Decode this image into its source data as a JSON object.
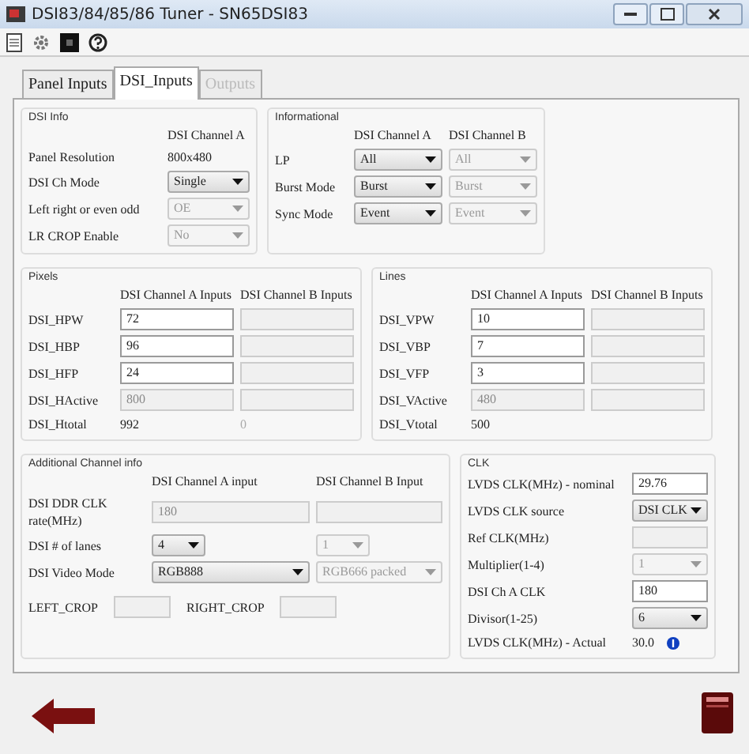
{
  "window": {
    "title": "DSI83/84/85/86 Tuner - SN65DSI83"
  },
  "tabs": [
    {
      "label": "Panel Inputs",
      "selected": false,
      "disabled": false
    },
    {
      "label": "DSI_Inputs",
      "selected": true,
      "disabled": false
    },
    {
      "label": "Outputs",
      "selected": false,
      "disabled": true
    }
  ],
  "dsi_info": {
    "title": "DSI Info",
    "headers": [
      "DSI Channel A"
    ],
    "rows": [
      {
        "label": "Panel Resolution",
        "a": {
          "kind": "text",
          "value": "800x480",
          "disabled": false
        }
      },
      {
        "label": "DSI Ch Mode",
        "a": {
          "kind": "select",
          "value": "Single",
          "disabled": false
        }
      },
      {
        "label": "Left right or even odd",
        "a": {
          "kind": "select",
          "value": "OE",
          "disabled": true
        }
      },
      {
        "label": "LR CROP Enable",
        "a": {
          "kind": "select",
          "value": "No",
          "disabled": true
        }
      }
    ]
  },
  "informational": {
    "title": "Informational",
    "headers": [
      "DSI Channel A",
      "DSI Channel B"
    ],
    "rows": [
      {
        "label": "LP",
        "a": {
          "kind": "select",
          "value": "All",
          "disabled": false
        },
        "b": {
          "kind": "select",
          "value": "All",
          "disabled": true
        }
      },
      {
        "label": "Burst Mode",
        "a": {
          "kind": "select",
          "value": "Burst",
          "disabled": false
        },
        "b": {
          "kind": "select",
          "value": "Burst",
          "disabled": true
        }
      },
      {
        "label": "Sync Mode",
        "a": {
          "kind": "select",
          "value": "Event",
          "disabled": false
        },
        "b": {
          "kind": "select",
          "value": "Event",
          "disabled": true
        }
      }
    ]
  },
  "pixels": {
    "title": "Pixels",
    "headers": [
      "DSI Channel A Inputs",
      "DSI Channel B Inputs"
    ],
    "rows": [
      {
        "label": "DSI_HPW",
        "a": {
          "kind": "input",
          "value": "72",
          "disabled": false
        },
        "b": {
          "kind": "input",
          "disabled": true
        }
      },
      {
        "label": "DSI_HBP",
        "a": {
          "kind": "input",
          "value": "96",
          "disabled": false
        },
        "b": {
          "kind": "input",
          "disabled": true
        }
      },
      {
        "label": "DSI_HFP",
        "a": {
          "kind": "input",
          "value": "24",
          "disabled": false
        },
        "b": {
          "kind": "input",
          "disabled": true
        }
      },
      {
        "label": "DSI_HActive",
        "a": {
          "kind": "input",
          "value": "800",
          "disabled": true
        },
        "b": {
          "kind": "input",
          "disabled": true
        }
      },
      {
        "label": "DSI_Htotal",
        "a": {
          "kind": "text",
          "value": "992",
          "disabled": false
        },
        "b": {
          "kind": "text",
          "value": "0",
          "disabled": true
        }
      }
    ]
  },
  "lines": {
    "title": "Lines",
    "headers": [
      "DSI Channel A Inputs",
      "DSI Channel B Inputs"
    ],
    "rows": [
      {
        "label": "DSI_VPW",
        "a": {
          "kind": "input",
          "value": "10",
          "disabled": false
        },
        "b": {
          "kind": "input",
          "disabled": true
        }
      },
      {
        "label": "DSI_VBP",
        "a": {
          "kind": "input",
          "value": "7",
          "disabled": false
        },
        "b": {
          "kind": "input",
          "disabled": true
        }
      },
      {
        "label": "DSI_VFP",
        "a": {
          "kind": "input",
          "value": "3",
          "disabled": false
        },
        "b": {
          "kind": "input",
          "disabled": true
        }
      },
      {
        "label": "DSI_VActive",
        "a": {
          "kind": "input",
          "value": "480",
          "disabled": true
        },
        "b": {
          "kind": "input",
          "disabled": true
        }
      },
      {
        "label": "DSI_Vtotal",
        "a": {
          "kind": "text",
          "value": "500",
          "disabled": false
        }
      }
    ]
  },
  "additional": {
    "title": "Additional Channel info",
    "headers": [
      "DSI Channel A input",
      "DSI Channel B Input"
    ],
    "rows": [
      {
        "label": "DSI DDR CLK rate(MHz)",
        "a": {
          "kind": "input",
          "value": "180",
          "disabled": true
        },
        "b": {
          "kind": "input",
          "disabled": true
        }
      },
      {
        "label": "DSI # of lanes",
        "a": {
          "kind": "select",
          "value": "4",
          "disabled": false
        },
        "b": {
          "kind": "select",
          "value": "1",
          "disabled": true
        }
      },
      {
        "label": "DSI Video Mode",
        "a": {
          "kind": "select",
          "value": "RGB888",
          "disabled": false
        },
        "b": {
          "kind": "select",
          "value": "RGB666 packed",
          "disabled": true
        }
      }
    ],
    "crop": [
      {
        "label": "LEFT_CROP",
        "field": {
          "kind": "input",
          "disabled": true
        }
      },
      {
        "label": "RIGHT_CROP",
        "field": {
          "kind": "input",
          "disabled": true
        }
      }
    ]
  },
  "clk": {
    "title": "CLK",
    "rows": [
      {
        "label": "LVDS CLK(MHz) - nominal",
        "a": {
          "kind": "input",
          "value": "29.76",
          "disabled": false
        }
      },
      {
        "label": "LVDS CLK source",
        "a": {
          "kind": "select",
          "value": "DSI CLK",
          "disabled": false
        }
      },
      {
        "label": "Ref CLK(MHz)",
        "a": {
          "kind": "input",
          "disabled": true
        }
      },
      {
        "label": "Multiplier(1-4)",
        "a": {
          "kind": "select",
          "value": "1",
          "disabled": true
        }
      },
      {
        "label": "DSI Ch A CLK",
        "a": {
          "kind": "input",
          "value": "180",
          "disabled": false
        }
      },
      {
        "label": "Divisor(1-25)",
        "a": {
          "kind": "select",
          "value": "6",
          "disabled": false
        }
      },
      {
        "label": "LVDS CLK(MHz)  -  Actual",
        "a": {
          "kind": "text",
          "value": "30.0",
          "disabled": false,
          "info": true
        }
      }
    ]
  }
}
